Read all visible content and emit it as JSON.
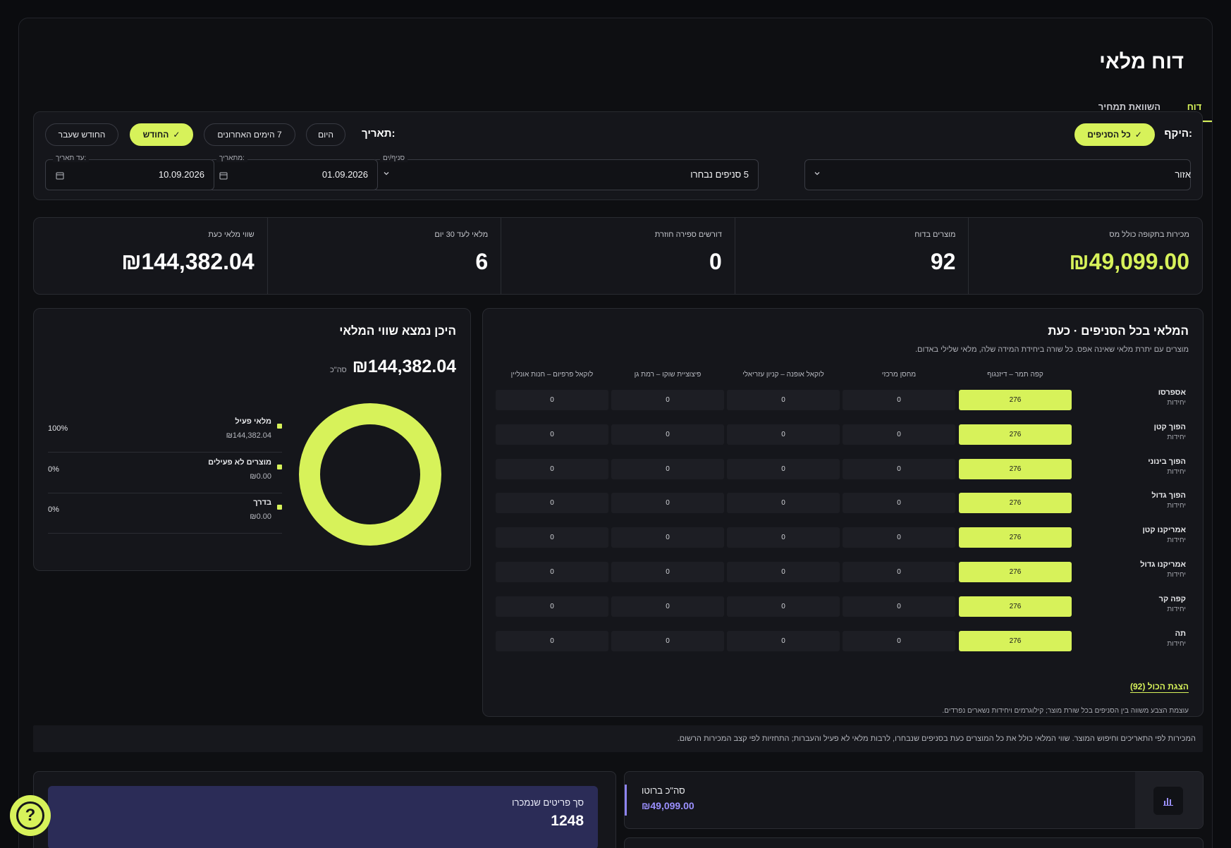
{
  "header": {
    "title": "דוח מלאי",
    "tabs": [
      {
        "label": "דוח",
        "active": true
      },
      {
        "label": "השוואת תמחיר",
        "active": false
      }
    ]
  },
  "filters": {
    "scope_label": "היקף:",
    "scope_chip": "כל הסניפים",
    "date_label": "תאריך:",
    "date_chips": [
      {
        "label": "היום",
        "selected": false
      },
      {
        "label": "7 הימים האחרונים",
        "selected": false
      },
      {
        "label": "החודש",
        "selected": true
      },
      {
        "label": "החודש שעבר",
        "selected": false
      }
    ],
    "region": {
      "value": "אזור"
    },
    "branches": {
      "legend": "סניף/ים",
      "value": "5 סניפים נבחרו"
    },
    "from": {
      "legend": "מתאריך:",
      "value": "01.09.2026"
    },
    "to": {
      "legend": "עד תאריך:",
      "value": "10.09.2026"
    }
  },
  "kpis": [
    {
      "label": "מכירות בתקופה כולל מס",
      "value": "₪49,099.00",
      "accent": true
    },
    {
      "label": "מוצרים בדוח",
      "value": "92",
      "accent": false
    },
    {
      "label": "דורשים ספירה חוזרת",
      "value": "0",
      "accent": false
    },
    {
      "label": "מלאי לעד 30 יום",
      "value": "6",
      "accent": false
    },
    {
      "label": "שווי מלאי כעת",
      "value": "₪144,382.04",
      "accent": false
    }
  ],
  "inventory": {
    "title": "המלאי בכל הסניפים · כעת",
    "subtitle": "מוצרים עם יתרת מלאי שאינה אפס. כל שורה ביחידת המידה שלה, מלאי שלילי באדום.",
    "columns": [
      "קפה תמר – דיזנגוף",
      "מחסן מרכזי",
      "לוקאל אופנה – קניון עזריאלי",
      "פיצוציית שוקו – רמת גן",
      "לוקאל פרפיום – חנות אונליין"
    ],
    "rows": [
      {
        "name": "אספרסו",
        "unit": "יחידות",
        "values": [
          "276",
          "0",
          "0",
          "0",
          "0"
        ]
      },
      {
        "name": "הפוך קטן",
        "unit": "יחידות",
        "values": [
          "276",
          "0",
          "0",
          "0",
          "0"
        ]
      },
      {
        "name": "הפוך בינוני",
        "unit": "יחידות",
        "values": [
          "276",
          "0",
          "0",
          "0",
          "0"
        ]
      },
      {
        "name": "הפוך גדול",
        "unit": "יחידות",
        "values": [
          "276",
          "0",
          "0",
          "0",
          "0"
        ]
      },
      {
        "name": "אמריקנו קטן",
        "unit": "יחידות",
        "values": [
          "276",
          "0",
          "0",
          "0",
          "0"
        ]
      },
      {
        "name": "אמריקנו גדול",
        "unit": "יחידות",
        "values": [
          "276",
          "0",
          "0",
          "0",
          "0"
        ]
      },
      {
        "name": "קפה קר",
        "unit": "יחידות",
        "values": [
          "276",
          "0",
          "0",
          "0",
          "0"
        ]
      },
      {
        "name": "תה",
        "unit": "יחידות",
        "values": [
          "276",
          "0",
          "0",
          "0",
          "0"
        ]
      }
    ],
    "show_all": "הצגת הכול (92)",
    "footnote": "עוצמת הצבע משווה בין הסניפים בכל שורת מוצר; קילוגרמים ויחידות נשארים נפרדים."
  },
  "value_panel": {
    "title": "היכן נמצא שווי המלאי",
    "total": "₪144,382.04",
    "total_suffix": "סה\"כ",
    "legend": [
      {
        "name": "מלאי פעיל",
        "value": "₪144,382.04",
        "pct": "100%",
        "fraction": 1.0
      },
      {
        "name": "מוצרים לא פעילים",
        "value": "₪0.00",
        "pct": "0%",
        "fraction": 0
      },
      {
        "name": "בדרך",
        "value": "₪0.00",
        "pct": "0%",
        "fraction": 0
      }
    ],
    "color": "#d7f25a"
  },
  "note": "המכירות לפי התאריכים וחיפוש המוצר. שווי המלאי כולל את כל המוצרים כעת בסניפים שנבחרו, לרבות מלאי לא פעיל והעברות; התחזיות לפי קצב המכירות הרשום.",
  "gross_card": {
    "label": "סה\"כ ברוטו",
    "value": "₪49,099.00",
    "icon": "bar-chart-icon"
  },
  "sold_card": {
    "label": "סך פריטים שנמכרו",
    "value": "1248"
  },
  "help": {
    "label": "?",
    "icon": "help-icon"
  }
}
